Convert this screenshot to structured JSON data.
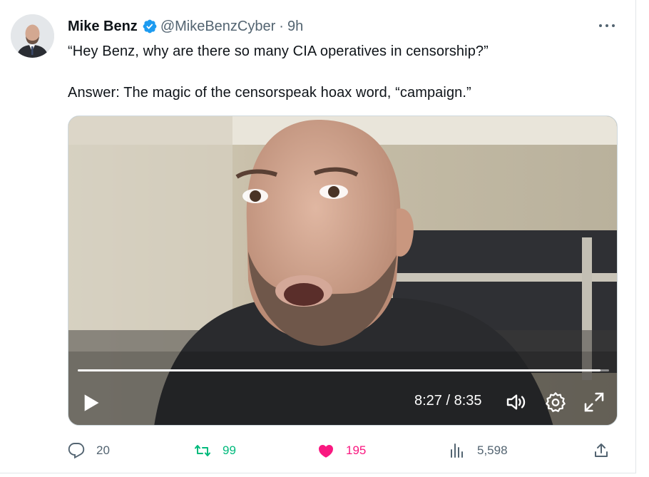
{
  "tweet": {
    "author_name": "Mike Benz",
    "handle": "@MikeBenzCyber",
    "separator": "·",
    "time_ago": "9h",
    "text_line1": "“Hey Benz, why are there so many CIA operatives in censorship?”",
    "text_line2": "Answer: The magic of the censorspeak hoax word, “campaign.”"
  },
  "video": {
    "time_display": "8:27 / 8:35",
    "progress_fraction": 0.984
  },
  "engagement": {
    "replies": "20",
    "retweets": "99",
    "likes": "195",
    "views": "5,598"
  },
  "colors": {
    "verified": "#1d9bf0",
    "retweet": "#00ba7c",
    "like": "#f91880",
    "secondary_text": "#536471"
  },
  "icons": {
    "verified": "verified-badge-icon",
    "more": "more-dots-icon",
    "play": "play-icon",
    "volume": "volume-icon",
    "settings": "gear-icon",
    "fullscreen": "fullscreen-icon",
    "reply": "reply-icon",
    "retweet": "retweet-icon",
    "like": "heart-icon",
    "views": "views-icon",
    "share": "share-icon"
  }
}
